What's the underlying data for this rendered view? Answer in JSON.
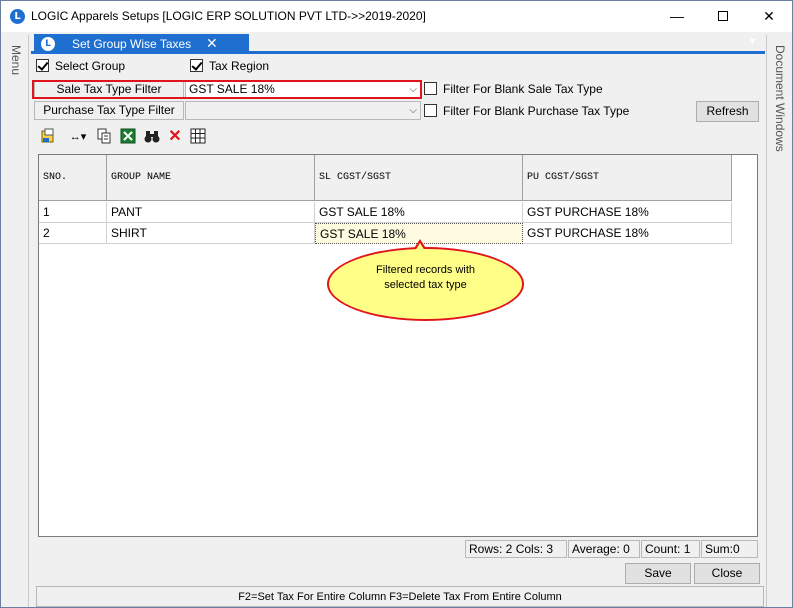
{
  "window": {
    "title": "LOGIC Apparels Setups  [LOGIC ERP SOLUTION PVT LTD->>2019-2020]",
    "minimize": "—",
    "close": "✕"
  },
  "side": {
    "left_label": "Menu",
    "right_label": "Document Windows"
  },
  "tab": {
    "label": "Set Group Wise Taxes",
    "close": "✕",
    "dropdown": "▼"
  },
  "options": {
    "select_group": "Select Group",
    "tax_region": "Tax Region"
  },
  "filters": {
    "sale_label": "Sale Tax Type Filter",
    "sale_value": "GST SALE 18%",
    "purchase_label": "Purchase Tax Type Filter",
    "purchase_value": "",
    "blank_sale": "Filter For Blank Sale Tax Type",
    "blank_purchase": "Filter For Blank Purchase Tax Type",
    "refresh": "Refresh"
  },
  "grid": {
    "columns": [
      "SNO.",
      "GROUP NAME",
      "SL CGST/SGST",
      "PU CGST/SGST"
    ],
    "rows": [
      [
        "1",
        "PANT",
        "GST SALE 18%",
        "GST PURCHASE 18%"
      ],
      [
        "2",
        "SHIRT",
        "GST SALE 18%",
        "GST PURCHASE 18%"
      ]
    ]
  },
  "callout": {
    "line1": "Filtered  records  with",
    "line2": "selected  tax  type"
  },
  "status": {
    "rows": "Rows: 2",
    "cols": "Cols: 3",
    "average": "Average: 0",
    "count": "Count: 1",
    "sum": "Sum:0"
  },
  "buttons": {
    "save": "Save",
    "close": "Close"
  },
  "footer": {
    "hint": "F2=Set Tax For Entire Column  F3=Delete Tax From Entire Column"
  },
  "colors": {
    "accent": "#1e6fd0",
    "highlight": "#e0141a",
    "callout_fill": "#ffff88"
  }
}
